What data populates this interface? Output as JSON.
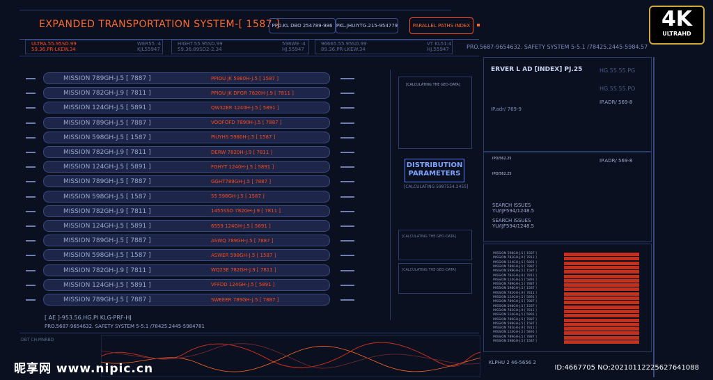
{
  "header": {
    "title": "EXPANDED TRANSPORTATION SYSTEM-[ 1587 ]",
    "pill1": "PPO.KL DBO 254789-986",
    "pill2": "PKL.JHUIYTG.215-954779",
    "parallel": "PARALLEL PATHS INDEX",
    "safety": "PRO.5687-9654632. SAFETY SYSTEM 5-5.1 /78425.2445-5984.57"
  },
  "stats": [
    {
      "a": "ULTRA.55.95SD.99",
      "b": "59.36.PR-LKEW.34",
      "c": "WER55 :4",
      "d": "KJL55947"
    },
    {
      "a": "HIGHT.55.95SD.99",
      "b": "59.36.89SD2-2.34",
      "c": "598WE :4",
      "d": "HJ.55947"
    },
    {
      "a": "96665.55.95SD.99",
      "b": "89.36.PR-LKEW.34",
      "c": "VT KL51:4",
      "d": "HJ.55947"
    }
  ],
  "missions": [
    {
      "label": "MISSION 789GH-J.5  [ 7887 ]",
      "value": "PPIOU JK 5980H-J.5  [ 1587 ]"
    },
    {
      "label": "MISSION 782GH-J.9  [ 7811 ]",
      "value": "PPIOU JK DFGR 7820H-J.9  [ 7811 ]"
    },
    {
      "label": "MISSION 124GH-J.5  [ 5891 ]",
      "value": "QW32ER 1240H-J.5  [ 5891 ]"
    },
    {
      "label": "MISSION 789GH-J.5  [ 7887 ]",
      "value": "VOOFOFD 7890H-J.5  [ 7887 ]"
    },
    {
      "label": "MISSION 598GH-J.5  [ 1587 ]",
      "value": "PIUYHS 5980H-J.5  [ 1587 ]"
    },
    {
      "label": "MISSION 782GH-J.9  [ 7811 ]",
      "value": "DERW 7820H-J.9  [ 7811 ]"
    },
    {
      "label": "MISSION 124GH-J.5  [ 5891 ]",
      "value": "FGHYT 1240H-J.5  [ 5891 ]"
    },
    {
      "label": "MISSION 789GH-J.5  [ 7887 ]",
      "value": "GGHT789GH-J.5  [ 7887 ]"
    },
    {
      "label": "MISSION 598GH-J.5  [ 1587 ]",
      "value": "55 598GH-J.5  [ 1587 ]"
    },
    {
      "label": "MISSION 782GH-J.9  [ 7811 ]",
      "value": "1455SSD 782GH-J.9  [ 7811 ]"
    },
    {
      "label": "MISSION 124GH-J.5  [ 5891 ]",
      "value": "6559 124GH-J.5  [ 5891 ]"
    },
    {
      "label": "MISSION 789GH-J.5  [ 7887 ]",
      "value": "ASWQ 789GH-J.5  [ 7887 ]"
    },
    {
      "label": "MISSION 598GH-J.5  [ 1587 ]",
      "value": "ASWER 598GH-J.5  [ 1587 ]"
    },
    {
      "label": "MISSION 782GH-J.9  [ 7811 ]",
      "value": "WQ23E 782GH-J.9  [ 7811 ]"
    },
    {
      "label": "MISSION 124GH-J.5  [ 5891 ]",
      "value": "VFFDD 124GH-J.5  [ 5891 ]"
    },
    {
      "label": "MISSION 789GH-J.5  [ 7887 ]",
      "value": "SWEEER 789GH-J.5  [ 7887 ]"
    }
  ],
  "footer_left": {
    "line1": "[ AE ]-953.56.HG.PI KLG-PRF-HJ",
    "line2": "PRO.5687-9654632. SAFETY SYSTEM 5-5.1 /78425.2445-5984781",
    "chart_label": "DBT  CH.MNRBD"
  },
  "middle": {
    "calc1": "[CALCULATING THE GEO-DATA]",
    "dist_line1": "DISTRIBUTION",
    "dist_line2": "PARAMETERS",
    "dist_sub": "[CALCULATING 5987554.2455]",
    "calc2": "[CALCULATING THE GEO-DATA]",
    "calc3": "[CALCULATING THE GEO-DATA]"
  },
  "right": {
    "server": "ERVER L  AD [INDEX] PJ.25",
    "hg1": "HG.55.55.PG",
    "hg2": "HG.55.55.PO",
    "ipa": "IP.adr/ 769-9",
    "ipadr1": "IP.ADR/ 569-8",
    "ipadr2": "IP.ADR/ 569-8",
    "ipo1": "IPO/562.25",
    "ipo2": "IPO/562.25",
    "search1a": "SEARCH ISSUES",
    "search1b": "YU/IJF594/1248.5",
    "search2a": "SEARCH ISSUES",
    "search2b": "YU/IJF594/1248.5",
    "bottom": "KLPHU 2  46-5656 2"
  },
  "right_list": [
    "MISSION 598GH-J.5  [ 1587 ]",
    "MISSION 782GH-J.9  [ 7811 ]",
    "MISSION 124GH-J.5  [ 5891 ]",
    "MISSION 789GH-J.5  [ 7887 ]",
    "MISSION 598GH-J.5  [ 1587 ]",
    "MISSION 782GH-J.9  [ 7811 ]",
    "MISSION 124GH-J.5  [ 5891 ]",
    "MISSION 789GH-J.5  [ 7887 ]",
    "MISSION 598GH-J.5  [ 1587 ]",
    "MISSION 782GH-J.9  [ 7811 ]",
    "MISSION 124GH-J.5  [ 5891 ]",
    "MISSION 789GH-J.5  [ 7887 ]",
    "MISSION 598GH-J.5  [ 1587 ]",
    "MISSION 782GH-J.9  [ 7811 ]",
    "MISSION 124GH-J.5  [ 5891 ]",
    "MISSION 789GH-J.5  [ 7887 ]",
    "MISSION 598GH-J.5  [ 1587 ]",
    "MISSION 782GH-J.9  [ 7811 ]",
    "MISSION 124GH-J.5  [ 5891 ]",
    "MISSION 789GH-J.5  [ 7887 ]",
    "MISSION 598GH-J.5  [ 1587 ]"
  ],
  "logo": {
    "big": "4K",
    "small": "ULTRAHD"
  },
  "watermark": {
    "left": "昵享网 www.nipic.cn",
    "right": "ID:4667705 NO:20210112225627641088"
  },
  "colors": {
    "accent": "#ff4a1c",
    "frame": "#3a4a82",
    "background": "#0b1020",
    "highlight": "#5c86ff"
  }
}
